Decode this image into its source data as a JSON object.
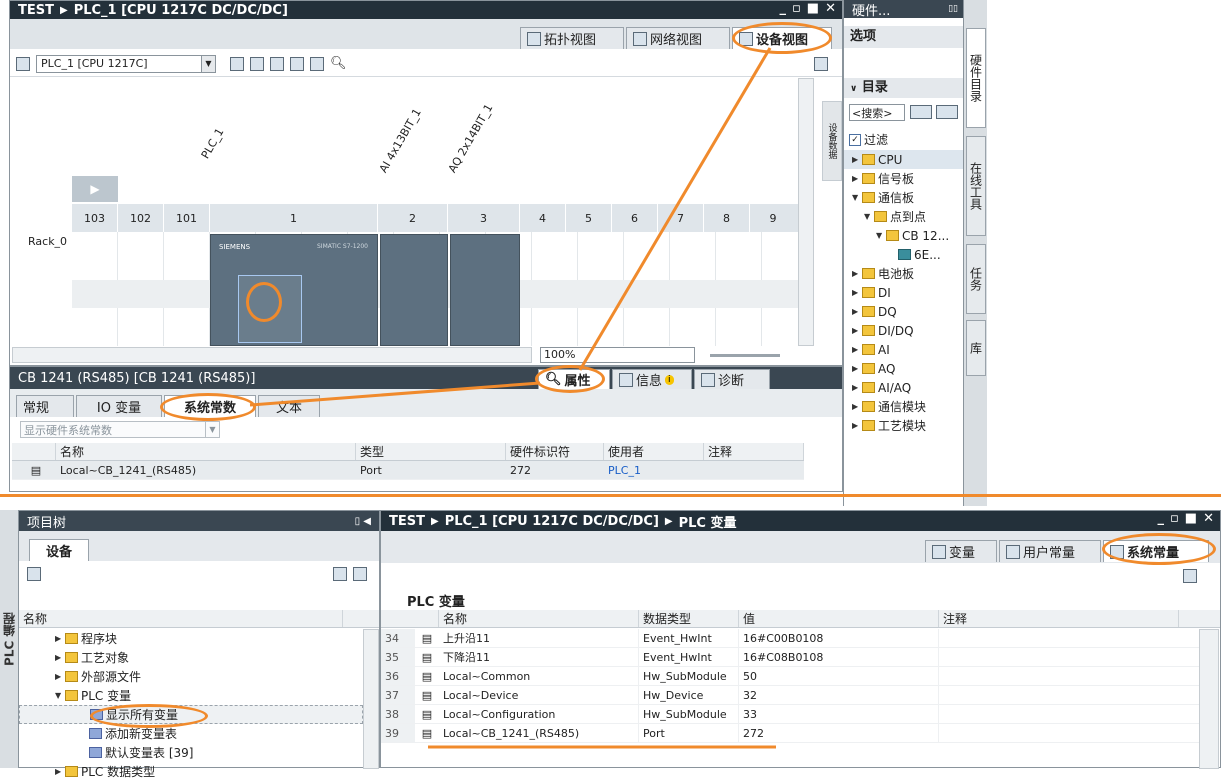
{
  "dev_window": {
    "title_project": "TEST",
    "title_device": "PLC_1 [CPU 1217C DC/DC/DC]",
    "tabs": [
      "拓扑视图",
      "网络视图",
      "设备视图"
    ],
    "device_select": "PLC_1 [CPU 1217C]",
    "zoom": "100%",
    "module_labels": [
      "PLC_1",
      "AI 4x13BIT_1",
      "AQ 2x14BIT_1"
    ],
    "rack_name": "Rack_0",
    "slots": [
      "103",
      "102",
      "101",
      "1",
      "2",
      "3",
      "4",
      "5",
      "6",
      "7",
      "8",
      "9"
    ],
    "plc_brand": "SIEMENS",
    "plc_model": "SIMATIC S7-1200",
    "side_tab": "设备数据"
  },
  "catalog": {
    "title": "硬件...",
    "options_label": "选项",
    "catalog_label": "目录",
    "search_placeholder": "<搜索>",
    "filter_label": "过滤",
    "items": [
      "CPU",
      "信号板",
      "通信板",
      "点到点",
      "CB 12...",
      "6E...",
      "电池板",
      "DI",
      "DQ",
      "DI/DQ",
      "AI",
      "AQ",
      "AI/AQ",
      "通信模块",
      "工艺模块"
    ],
    "side_tabs": [
      "硬件目录",
      "在线工具",
      "任务",
      "库"
    ]
  },
  "props": {
    "title": "CB 1241 (RS485) [CB 1241 (RS485)]",
    "right_tabs": [
      "属性",
      "信息",
      "诊断"
    ],
    "tabs": [
      "常规",
      "IO 变量",
      "系统常数",
      "文本"
    ],
    "dropdown": "显示硬件系统常数",
    "columns": [
      "名称",
      "类型",
      "硬件标识符",
      "使用者",
      "注释"
    ],
    "rows": [
      {
        "name": "Local~CB_1241_(RS485)",
        "type": "Port",
        "hwid": "272",
        "user": "PLC_1",
        "comment": ""
      }
    ]
  },
  "tree": {
    "title": "项目树",
    "tab": "设备",
    "column": "名称",
    "side_label": "PLC 编程",
    "items": [
      "程序块",
      "工艺对象",
      "外部源文件",
      "PLC 变量",
      "显示所有变量",
      "添加新变量表",
      "默认变量表 [39]",
      "PLC 数据类型"
    ]
  },
  "tags": {
    "title_project": "TEST",
    "title_device": "PLC_1 [CPU 1217C DC/DC/DC]",
    "title_section": "PLC 变量",
    "tabs": [
      "变量",
      "用户常量",
      "系统常量"
    ],
    "heading": "PLC 变量",
    "columns": [
      "名称",
      "数据类型",
      "值",
      "注释"
    ],
    "rows": [
      {
        "no": "34",
        "name": "上升沿11",
        "type": "Event_HwInt",
        "value": "16#C00B0108"
      },
      {
        "no": "35",
        "name": "下降沿11",
        "type": "Event_HwInt",
        "value": "16#C08B0108"
      },
      {
        "no": "36",
        "name": "Local~Common",
        "type": "Hw_SubModule",
        "value": "50"
      },
      {
        "no": "37",
        "name": "Local~Device",
        "type": "Hw_Device",
        "value": "32"
      },
      {
        "no": "38",
        "name": "Local~Configuration",
        "type": "Hw_SubModule",
        "value": "33"
      },
      {
        "no": "39",
        "name": "Local~CB_1241_(RS485)",
        "type": "Port",
        "value": "272"
      }
    ]
  },
  "colors": {
    "accent": "#f08a2c",
    "titlebar": "#23303a",
    "link": "#1a5fc8"
  }
}
